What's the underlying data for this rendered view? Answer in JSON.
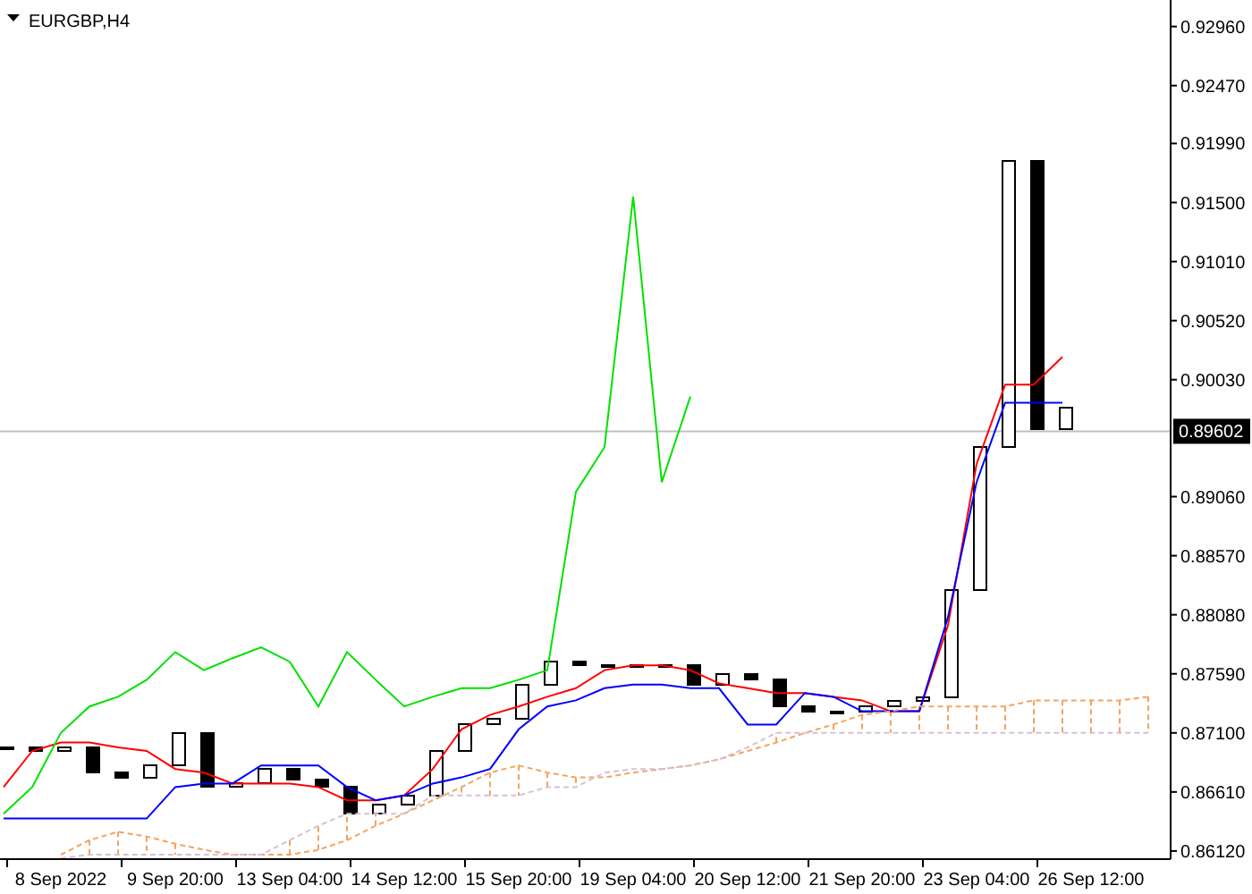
{
  "chart_data": {
    "type": "line",
    "title": "EURGBP,H4",
    "categories": [
      null,
      null,
      "8 Sep 2022",
      null,
      null,
      null,
      "9 Sep 20:00",
      null,
      null,
      null,
      "13 Sep 04:00",
      null,
      null,
      null,
      "14 Sep 12:00",
      null,
      null,
      null,
      "15 Sep 20:00",
      null,
      null,
      null,
      "19 Sep 04:00",
      null,
      null,
      null,
      "20 Sep 12:00",
      null,
      null,
      null,
      "21 Sep 20:00",
      null,
      null,
      null,
      "23 Sep 04:00",
      null,
      null,
      null,
      "26 Sep 12:00",
      null,
      null
    ],
    "ylim": [
      0.8606,
      0.9318
    ],
    "yticks": [
      {
        "value": 0.9296,
        "label": "0.92960"
      },
      {
        "value": 0.9247,
        "label": "0.92470"
      },
      {
        "value": 0.9199,
        "label": "0.91990"
      },
      {
        "value": 0.915,
        "label": "0.91500"
      },
      {
        "value": 0.9101,
        "label": "0.91010"
      },
      {
        "value": 0.9052,
        "label": "0.90520"
      },
      {
        "value": 0.9003,
        "label": "0.90030"
      },
      {
        "value": 0.8906,
        "label": "0.89060"
      },
      {
        "value": 0.8857,
        "label": "0.88570"
      },
      {
        "value": 0.8808,
        "label": "0.88080"
      },
      {
        "value": 0.8759,
        "label": "0.87590"
      },
      {
        "value": 0.871,
        "label": "0.87100"
      },
      {
        "value": 0.8661,
        "label": "0.86610"
      },
      {
        "value": 0.8612,
        "label": "0.86120"
      }
    ],
    "series": [
      {
        "color": "#ff0000",
        "values": [
          0.8665,
          0.8695,
          0.8702,
          0.8702,
          0.8698,
          0.8695,
          0.868,
          0.8677,
          0.8668,
          0.8668,
          0.8668,
          0.8665,
          0.8654,
          0.8654,
          0.8658,
          0.868,
          0.8713,
          0.8725,
          0.8732,
          0.874,
          0.8747,
          0.8762,
          0.8766,
          0.8766,
          0.8762,
          0.8751,
          0.8747,
          0.8743,
          0.8743,
          0.874,
          0.8737,
          0.8728,
          0.8728,
          0.8799,
          0.8933,
          0.8999,
          0.8999,
          0.9022,
          null,
          null,
          null
        ]
      },
      {
        "color": "#0000ff",
        "values": [
          0.8639,
          0.8639,
          0.8639,
          0.8639,
          0.8639,
          0.8639,
          0.8665,
          0.8668,
          0.8668,
          0.8683,
          0.8683,
          0.8683,
          0.8665,
          0.8654,
          0.8658,
          0.8668,
          0.8673,
          0.868,
          0.8713,
          0.8732,
          0.8737,
          0.8747,
          0.875,
          0.875,
          0.8747,
          0.8747,
          0.8717,
          0.8717,
          0.8743,
          0.874,
          0.8728,
          0.8728,
          0.8728,
          0.8806,
          0.8918,
          0.8984,
          0.8984,
          0.8984,
          null,
          null,
          null
        ]
      },
      {
        "color": "#00e000",
        "values": [
          0.8643,
          0.8665,
          0.871,
          0.8732,
          0.874,
          0.8754,
          0.8777,
          0.8762,
          0.8772,
          0.8781,
          0.8769,
          0.8732,
          0.8777,
          0.8754,
          0.8732,
          0.874,
          0.8747,
          0.8747,
          0.8754,
          0.8762,
          0.891,
          0.8947,
          0.9155,
          0.8918,
          0.8989,
          null,
          null,
          null,
          null,
          null,
          null,
          null,
          null,
          null,
          null,
          null,
          null,
          null,
          null,
          null,
          null
        ]
      },
      {
        "color": "#f4a460",
        "line_style": "dashed",
        "values": [
          null,
          null,
          0.8609,
          0.8621,
          0.8628,
          0.8624,
          0.8618,
          0.8613,
          0.8609,
          0.8609,
          0.8609,
          0.8613,
          0.8621,
          0.8633,
          0.8643,
          0.8654,
          0.8665,
          0.8677,
          0.8683,
          0.8677,
          0.8673,
          0.8673,
          0.8677,
          0.868,
          0.8683,
          0.8688,
          0.8695,
          0.8702,
          0.871,
          0.8717,
          0.8725,
          0.8728,
          0.8732,
          0.8732,
          0.8732,
          0.8732,
          0.8737,
          0.8737,
          0.8737,
          0.8737,
          0.874
        ]
      },
      {
        "color": "#d8bfd8",
        "line_style": "dashed",
        "values": [
          null,
          null,
          0.8606,
          0.8609,
          0.8609,
          0.8609,
          0.8609,
          0.8609,
          0.8609,
          0.8609,
          0.8621,
          0.8633,
          0.8643,
          0.8643,
          0.8643,
          0.8658,
          0.8658,
          0.8658,
          0.8658,
          0.8665,
          0.8665,
          0.8677,
          0.868,
          0.868,
          0.8683,
          0.8688,
          0.8698,
          0.871,
          0.871,
          0.871,
          0.871,
          0.871,
          0.871,
          0.871,
          0.871,
          0.871,
          0.871,
          0.871,
          0.871,
          0.871,
          0.871
        ]
      }
    ]
  },
  "current_price": "0.89602"
}
